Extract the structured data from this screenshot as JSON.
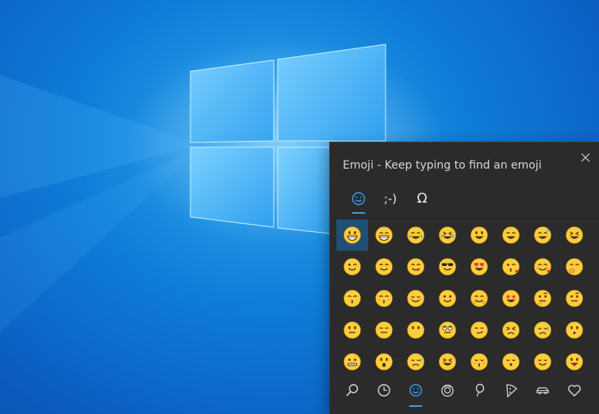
{
  "panel": {
    "title": "Emoji - Keep typing to find an emoji",
    "close_icon": "close-icon"
  },
  "tabs": [
    {
      "id": "emoji",
      "icon": "smiley-icon",
      "label": "",
      "active": true
    },
    {
      "id": "kaomoji",
      "icon": "",
      "label": ";-)",
      "active": false
    },
    {
      "id": "symbols",
      "icon": "",
      "label": "Ω",
      "active": false
    }
  ],
  "colors": {
    "accent": "#3b9eea",
    "emoji_face": "#ffcd3c",
    "emoji_outline": "#c98a12",
    "panel_bg": "#2b2b2b",
    "selected_cell": "#1f4f74"
  },
  "emojis": [
    "grinning-face",
    "beaming-face",
    "face-with-tears-of-joy",
    "rolling-on-floor-laughing",
    "grinning-big-eyes",
    "grinning-smiling-eyes",
    "grinning-sweat",
    "squinting-laughing",
    "winking-face",
    "smiling-face",
    "face-savoring-food",
    "smiling-sunglasses",
    "heart-eyes",
    "face-blowing-kiss",
    "smiling-hearts",
    "face-with-hand-over-mouth",
    "shushing-face",
    "kissing-smiling-eyes",
    "relaxed-face",
    "slightly-smiling",
    "hugging-face",
    "star-struck",
    "thinking-face",
    "face-raised-eyebrow",
    "neutral-face",
    "expressionless-face",
    "face-without-mouth",
    "face-rolling-eyes",
    "smirking-face",
    "persevering-face",
    "sad-relieved-face",
    "hushed-face",
    "zipper-mouth-face",
    "face-open-mouth",
    "sleepy-face",
    "tired-face",
    "kissing-closed-eyes",
    "sleeping-face",
    "relieved-face",
    "face-with-tongue"
  ],
  "selected_index": 0,
  "categories": [
    {
      "id": "search",
      "icon": "search-icon",
      "active": false
    },
    {
      "id": "recent",
      "icon": "clock-icon",
      "active": false
    },
    {
      "id": "smileys",
      "icon": "smiley-icon",
      "active": true
    },
    {
      "id": "people",
      "icon": "person-icon",
      "active": false
    },
    {
      "id": "celebration",
      "icon": "balloon-icon",
      "active": false
    },
    {
      "id": "food",
      "icon": "pizza-icon",
      "active": false
    },
    {
      "id": "transport",
      "icon": "car-icon",
      "active": false
    },
    {
      "id": "symbols",
      "icon": "heart-icon",
      "active": false
    }
  ]
}
